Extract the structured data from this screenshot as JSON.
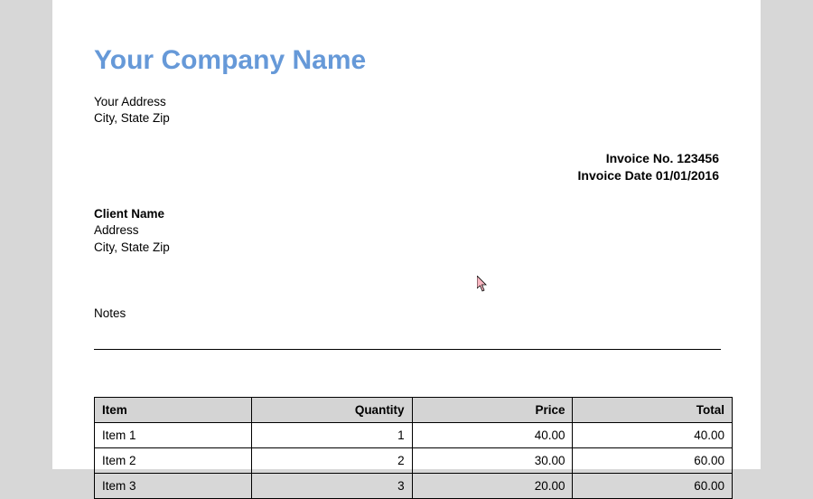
{
  "company": {
    "name": "Your Company Name",
    "address_line1": "Your Address",
    "address_line2": "City, State Zip"
  },
  "invoice": {
    "number_label": "Invoice No. ",
    "number": "123456",
    "date_label": "Invoice Date ",
    "date": "01/01/2016"
  },
  "client": {
    "name": "Client Name",
    "address_line1": "Address",
    "address_line2": "City, State Zip"
  },
  "notes": {
    "label": "Notes"
  },
  "table": {
    "headers": {
      "item": "Item",
      "quantity": "Quantity",
      "price": "Price",
      "total": "Total"
    },
    "rows": [
      {
        "item": "Item 1",
        "quantity": "1",
        "price": "40.00",
        "total": "40.00"
      },
      {
        "item": "Item 2",
        "quantity": "2",
        "price": "30.00",
        "total": "60.00"
      },
      {
        "item": "Item 3",
        "quantity": "3",
        "price": "20.00",
        "total": "60.00"
      }
    ]
  }
}
